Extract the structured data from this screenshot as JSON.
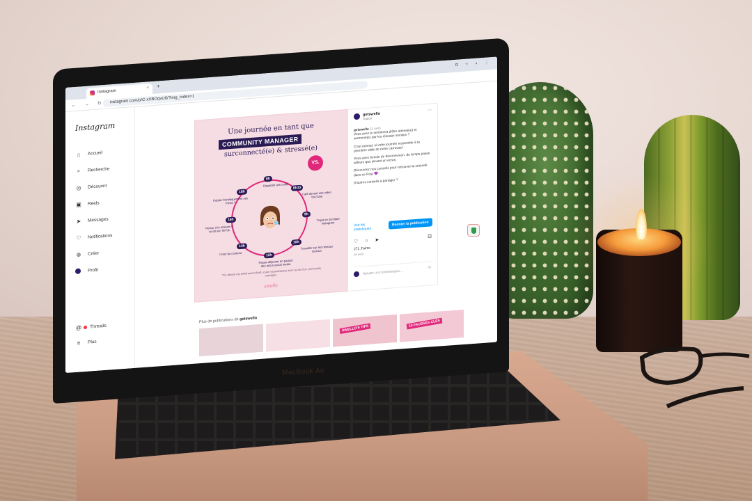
{
  "browser": {
    "tab_title": "Instagram",
    "tab_close": "×",
    "new_tab": "+",
    "nav": "← → ↻",
    "url": "instagram.com/p/C-xXBOqvU0/?img_index=1"
  },
  "sidebar": {
    "logo": "Instagram",
    "items": [
      {
        "label": "Accueil",
        "icon": "home-icon",
        "glyph": "⌂"
      },
      {
        "label": "Recherche",
        "icon": "search-icon",
        "glyph": "⌕"
      },
      {
        "label": "Découvrir",
        "icon": "compass-icon",
        "glyph": "◎"
      },
      {
        "label": "Reels",
        "icon": "reels-icon",
        "glyph": "▣"
      },
      {
        "label": "Messages",
        "icon": "send-icon",
        "glyph": "➤"
      },
      {
        "label": "Notifications",
        "icon": "heart-icon",
        "glyph": "♡"
      },
      {
        "label": "Créer",
        "icon": "plus-icon",
        "glyph": "⊕"
      },
      {
        "label": "Profil",
        "icon": "avatar-icon",
        "glyph": ""
      }
    ],
    "bottom": [
      {
        "label": "Threads",
        "icon": "threads-icon",
        "glyph": "@"
      },
      {
        "label": "Plus",
        "icon": "menu-icon",
        "glyph": "≡"
      }
    ]
  },
  "post_image": {
    "title_line1": "Une journée en tant que",
    "title_line2": "COMMUNITY MANAGER",
    "title_line3": "surconnecté(e) & stressé(e)",
    "vs_badge": "VS.",
    "timeline": [
      {
        "time": "8h",
        "caption": "Regarder ses notifs"
      },
      {
        "time": "8h15",
        "caption": "Café devant une vidéo YouTube"
      },
      {
        "time": "9h",
        "caption": "Trajet en scrollant Instagram"
      },
      {
        "time": "10h",
        "caption": "Travailler sur les réseaux sociaux"
      },
      {
        "time": "12h",
        "caption": "Pause déjeuner en parlant des actus social media"
      },
      {
        "time": "14h",
        "caption": "Créer du contenu"
      },
      {
        "time": "16h",
        "caption": "Retour à la maison et scroll sur TikTok"
      },
      {
        "time": "18h",
        "caption": "Publier frénétiquement ses Posts ?"
      }
    ],
    "footnote": "*Ce dessin est entièrement fictif, toute ressemblance avec la vie d'un community manager...",
    "brand": "swello"
  },
  "post_panel": {
    "account": "getswello",
    "location": "Toulon",
    "more": "···",
    "caption_user": "getswello",
    "caption_time": "11 sem",
    "caption": [
      "Vous avez le sentiment d'être stressé(e) et surmené(e) par les réseaux sociaux ?",
      "C'est normal, si votre journée ressemble à la première slide de notre carrousel.",
      "Vous avez besoin de déconnexion, de temps passé ailleurs que devant un écran.",
      "Découvrez nos conseils pour retrouver la sérénité dans ce Post 💜",
      "D'autres conseils à partager ?"
    ],
    "stats_link": "Voir les statistiques",
    "boost_button": "Booster la publication",
    "actions": "♡ ○ ➤",
    "save": "⊡",
    "likes": "271 J'aime",
    "date": "16 août",
    "comment_placeholder": "Ajouter un commentaire...",
    "emoji": "☺"
  },
  "more_posts": {
    "label_prefix": "Plus de publications de",
    "label_account": "getswello",
    "thumb_tags": [
      "",
      "",
      "SWELLO'S TIPS",
      "10 FAUSSES CLÉS"
    ]
  },
  "laptop": {
    "brand": "MacBook Air"
  },
  "colors": {
    "accent_pink": "#e0287a",
    "ig_blue": "#0095f6",
    "navy": "#2b1b55"
  }
}
